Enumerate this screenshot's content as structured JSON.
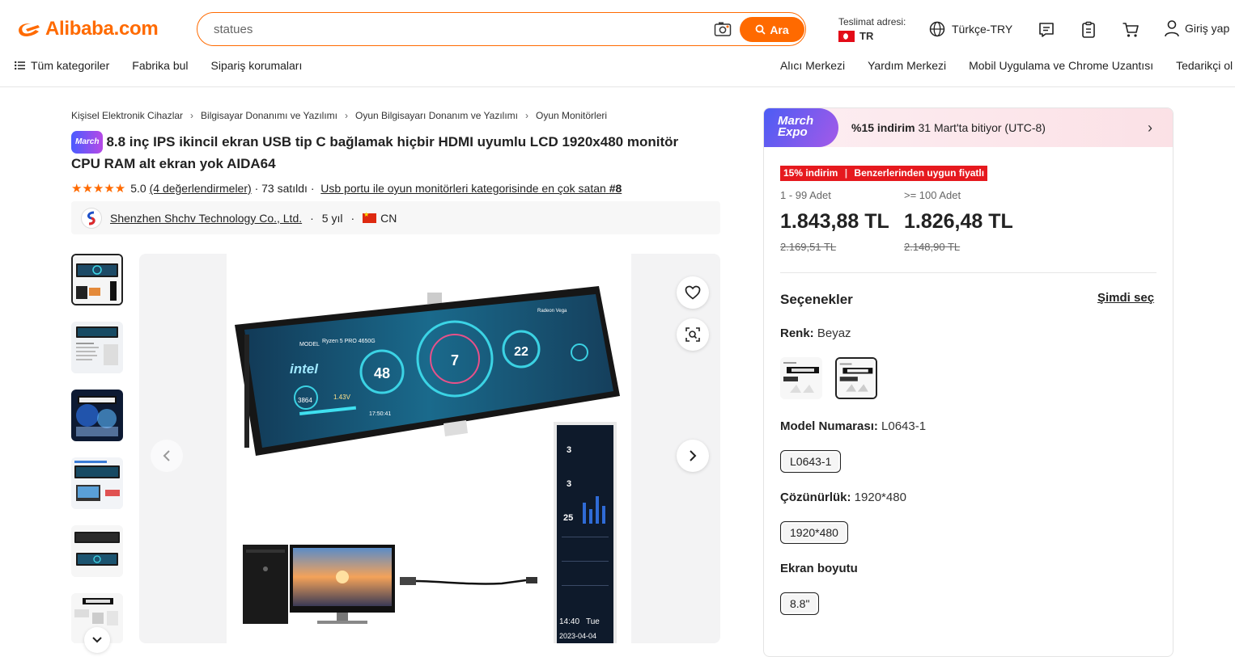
{
  "header": {
    "logo_text": "Alibaba.com",
    "search_value": "statues",
    "search_button": "Ara",
    "ship_label": "Teslimat adresi:",
    "ship_country": "TR",
    "language": "Türkçe-TRY",
    "login": "Giriş yap",
    "brand_color": "#ff6a00"
  },
  "nav": {
    "left": [
      "Tüm kategoriler",
      "Fabrika bul",
      "Sipariş korumaları"
    ],
    "right": [
      "Alıcı Merkezi",
      "Yardım Merkezi",
      "Mobil Uygulama ve Chrome Uzantısı",
      "Tedarikçi ol"
    ]
  },
  "breadcrumb": [
    "Kişisel Elektronik Cihazlar",
    "Bilgisayar Donanımı ve Yazılımı",
    "Oyun Bilgisayarı Donanım ve Yazılımı",
    "Oyun Monitörleri"
  ],
  "product": {
    "badge": "March",
    "title": "8.8 inç IPS ikincil ekran USB tip C bağlamak hiçbir HDMI uyumlu LCD 1920x480 monitör CPU RAM alt ekran yok AIDA64",
    "rating": "5.0",
    "reviews": "(4 değerlendirmeler)",
    "sold": "· 73 satıldı ·",
    "bestseller": "Usb portu ile oyun monitörleri kategorisinde en çok satan",
    "bestseller_rank": "#8"
  },
  "supplier": {
    "name": "Shenzhen Shchv Technology Co., Ltd.",
    "years": "5 yıl",
    "country": "CN"
  },
  "panel": {
    "expo_line1": "March",
    "expo_line2": "Expo",
    "promo_bold": "%15 indirim",
    "promo_rest": "31 Mart'ta bitiyor (UTC-8)",
    "discount_tag": "15% indirim",
    "discount_tag2": "Benzerlerinden uygun fiyatlı",
    "tiers": [
      {
        "qty": "1 - 99 Adet",
        "price": "1.843,88 TL",
        "old": "2.169,51 TL"
      },
      {
        "qty": ">= 100 Adet",
        "price": "1.826,48 TL",
        "old": "2.148,90 TL"
      }
    ],
    "options_title": "Seçenekler",
    "choose_now": "Şimdi seç",
    "color_label": "Renk:",
    "color_value": "Beyaz",
    "model_label": "Model Numarası:",
    "model_value": "L0643-1",
    "model_chip": "L0643-1",
    "res_label": "Çözünürlük:",
    "res_value": "1920*480",
    "res_chip": "1920*480",
    "size_label": "Ekran boyutu",
    "size_chip": "8.8\""
  },
  "icons": [
    "logo-icon",
    "camera-icon",
    "search-icon",
    "globe-icon",
    "message-icon",
    "orders-icon",
    "cart-icon",
    "user-icon",
    "menu-icon",
    "chevron-right-icon",
    "heart-icon",
    "zoom-icon",
    "chevron-left-icon",
    "chevron-down-icon"
  ],
  "monitor_screen": {
    "model_label": "MODEL",
    "model_value": "Ryzen 5 PRO 4650G",
    "brand": "intel",
    "cpu_temp": "48",
    "center_value": "7",
    "right_value": "22",
    "right_model": "Radeon Vega",
    "clock_value": "3864",
    "voltage_value": "1.43V",
    "time": "17:50:41"
  },
  "side_screen": {
    "time": "14:40",
    "weekday": "Tue",
    "date": "2023-04-04",
    "value_a": "3",
    "value_b": "3",
    "value_c": "25"
  }
}
